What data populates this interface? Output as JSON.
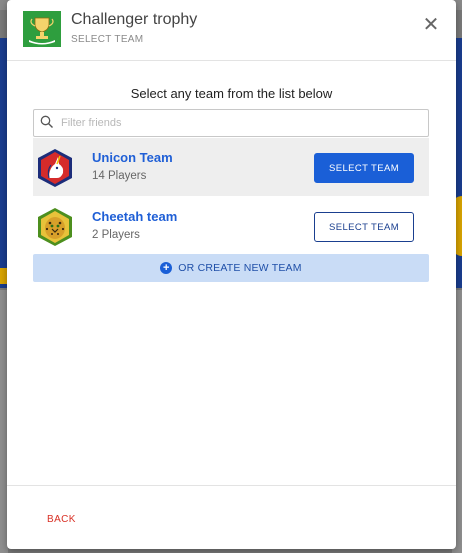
{
  "header": {
    "title": "Challenger trophy",
    "subtitle": "SELECT TEAM",
    "close_icon": "close-icon"
  },
  "instruction": "Select any team from the list below",
  "search": {
    "placeholder": "Filter friends",
    "value": ""
  },
  "teams": [
    {
      "name": "Unicon Team",
      "players": "14 Players",
      "button": "SELECT TEAM",
      "selected": true
    },
    {
      "name": "Cheetah team",
      "players": "2 Players",
      "button": "SELECT TEAM",
      "selected": false
    }
  ],
  "create_team_label": "OR CREATE NEW TEAM",
  "footer": {
    "back_label": "BACK"
  },
  "colors": {
    "primary": "#1a5fd7",
    "team_name": "#1f5fd6",
    "back": "#d93025",
    "create_bg": "#c9dcf6"
  }
}
